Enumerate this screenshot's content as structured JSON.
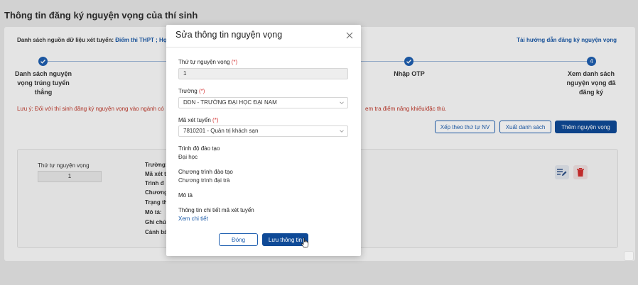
{
  "page": {
    "title": "Thông tin đăng ký nguyện vọng của thí sinh",
    "source_label": "Danh sách nguồn dữ liệu xét tuyển:",
    "source_value": "Điểm thi THPT ; Học",
    "guide_link": "Tải hướng dẫn đăng ký nguyện vọng",
    "steps": [
      {
        "label": "Danh sách nguyện vọng trúng tuyển thẳng",
        "state": "done"
      },
      {
        "label": "Nhập OTP",
        "state": "done"
      },
      {
        "label": "Xem danh sách nguyện vọng đã đăng ký",
        "number": "4",
        "state": "current"
      }
    ],
    "note_start": "Lưu ý: Đối với thí sinh đăng ký nguyện vọng vào ngành có",
    "note_end": "em tra điểm năng khiếu/đặc thù.",
    "buttons": {
      "sort": "Xếp theo thứ tự NV",
      "export": "Xuất danh sách",
      "add": "Thêm nguyện vọng"
    },
    "item": {
      "order_label": "Thứ tự nguyện vọng",
      "order_value": "1",
      "fields": [
        "Trường:",
        "Mã xét t",
        "Trình đ",
        "Chương",
        "Trạng th",
        "Mô tả:",
        "Ghi chú:",
        "Cảnh bá"
      ]
    }
  },
  "modal": {
    "title": "Sửa thông tin nguyện vọng",
    "order_label": "Thứ tự nguyện vọng",
    "required_mark": "(*)",
    "order_value": "1",
    "school_label": "Trường",
    "school_value": "DDN - TRƯỜNG ĐẠI HỌC ĐẠI NAM",
    "code_label": "Mã xét tuyển",
    "code_value": "7810201 - Quản trị khách sạn",
    "level_label": "Trình độ đào tạo",
    "level_value": "Đại học",
    "program_label": "Chương trình đào tạo",
    "program_value": "Chương trình đại trà",
    "desc_label": "Mô tả",
    "detail_label": "Thông tin chi tiết mã xét tuyển",
    "detail_link": "Xem chi tiết",
    "close_button": "Đóng",
    "save_button": "Lưu thông tin"
  },
  "colors": {
    "primary": "#0f4a97",
    "link": "#1b5aa8",
    "required": "#d63a3a",
    "warning_text": "#c0392b",
    "delete": "#d32f2f"
  },
  "icons": [
    "close-icon",
    "chevron-down-icon",
    "check-icon",
    "edit-list-icon",
    "trash-icon",
    "cursor-hand-icon"
  ]
}
